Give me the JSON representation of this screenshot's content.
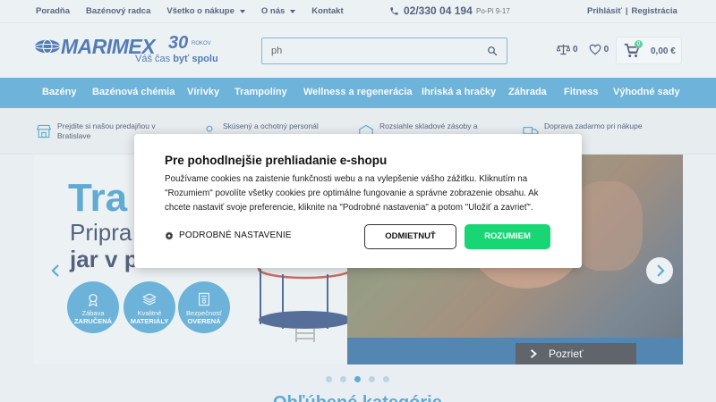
{
  "topbar": {
    "links": [
      "Poradňa",
      "Bazénový radca"
    ],
    "dropdowns": [
      "Všetko o nákupe",
      "O nás"
    ],
    "contact": "Kontakt",
    "phone": "02/330 04 194",
    "hours": "Po-Pi 9-17",
    "login": "Prihlásiť",
    "separator": "|",
    "register": "Registrácia"
  },
  "header": {
    "brand": "MARIMEX",
    "years": "30",
    "years_suffix": "ROKOV",
    "tagline_prefix": "Váš čas ",
    "tagline_bold": "byť spolu",
    "search_value": "ph",
    "compare_count": "0",
    "wishlist_count": "0",
    "cart_badge": "0",
    "cart_price": "0,00 €"
  },
  "nav": [
    "Bazény",
    "Bazénová chémia",
    "Vírivky",
    "Trampolíny",
    "Wellness a regenerácia",
    "Ihriská a hračky",
    "Záhrada",
    "Fitness",
    "Výhodné sady"
  ],
  "benefits": [
    {
      "line1": "Prejdite si našou predajňou v",
      "line2": "Bratislave"
    },
    {
      "line1": "Skúsený a ochotný personál",
      "line2": ""
    },
    {
      "line1": "Rozsiahle skladové zásoby a",
      "line2": ""
    },
    {
      "line1": "Doprava zadarmo pri nákupe",
      "line2": ""
    }
  ],
  "hero": {
    "title": "Tra",
    "subtitle1": "Pripra",
    "subtitle2": "jar v p",
    "badges": [
      {
        "top": "Zábava",
        "bottom": "ZARUČENÁ"
      },
      {
        "top": "Kvalitné",
        "bottom": "MATERIÁLY"
      },
      {
        "top": "Bezpečnosť",
        "bottom": "OVERENÁ"
      }
    ],
    "cta": "Pozrieť",
    "slide_count": 5,
    "active_slide": 3
  },
  "bottom_heading": "Obľúbené kategórie",
  "cookie": {
    "title": "Pre pohodlnejšie prehliadanie e-shopu",
    "text": "Používame cookies na zaistenie funkčnosti webu a na vylepšenie vášho zážitku. Kliknutím na \"Rozumiem\" povolíte všetky cookies pre optimálne fungovanie a správne zobrazenie obsahu. Ak chcete nastaviť svoje preferencie, kliknite na \"Podrobné nastavenia\" a potom \"Uložiť a zavrieť\".",
    "settings": "PODROBNÉ NASTAVENIE",
    "reject": "ODMIETNUŤ",
    "accept": "ROZUMIEM"
  },
  "colors": {
    "brand": "#1b4f9c",
    "nav": "#3f9ccf",
    "accept": "#19d674",
    "accent": "#2c8fc6"
  }
}
